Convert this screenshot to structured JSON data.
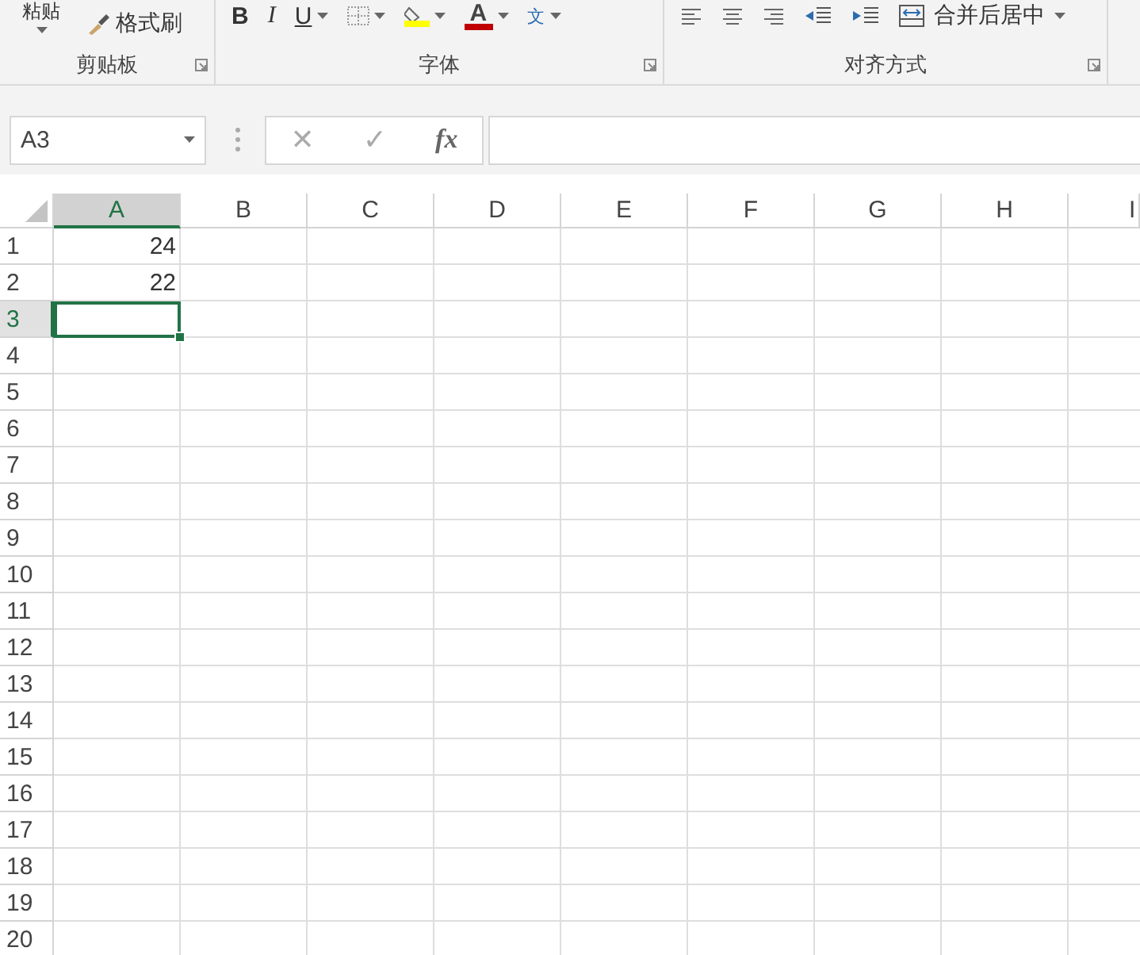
{
  "ribbon": {
    "groups": [
      {
        "label": "剪贴板",
        "items": [
          {
            "kind": "text",
            "label": "粘贴"
          },
          {
            "kind": "brush",
            "label": "格式刷"
          }
        ]
      },
      {
        "label": "字体",
        "items": [
          {
            "kind": "bold",
            "label": "B"
          },
          {
            "kind": "italic",
            "label": "I"
          },
          {
            "kind": "underline",
            "label": "U"
          },
          {
            "kind": "borders"
          },
          {
            "kind": "fill",
            "color": "#ffff00"
          },
          {
            "kind": "fontcolor",
            "label": "A",
            "color": "#c00000"
          },
          {
            "kind": "phonetic",
            "label": "文"
          }
        ]
      },
      {
        "label": "对齐方式",
        "items": [
          {
            "kind": "align-left"
          },
          {
            "kind": "align-center"
          },
          {
            "kind": "align-right"
          },
          {
            "kind": "outdent"
          },
          {
            "kind": "indent"
          },
          {
            "kind": "merge",
            "label": "合并后居中"
          }
        ]
      }
    ]
  },
  "formula_bar": {
    "name_box": "A3",
    "cancel": "✕",
    "enter": "✓",
    "function": "fx"
  },
  "sheet": {
    "columns": [
      {
        "label": "A",
        "selected": true
      },
      {
        "label": "B",
        "selected": false
      },
      {
        "label": "C",
        "selected": false
      },
      {
        "label": "D",
        "selected": false
      },
      {
        "label": "E",
        "selected": false
      },
      {
        "label": "F",
        "selected": false
      },
      {
        "label": "G",
        "selected": false
      },
      {
        "label": "H",
        "selected": false
      },
      {
        "label": "I",
        "selected": false
      }
    ],
    "rows": [
      {
        "label": "1",
        "selected": false,
        "cells": [
          {
            "value": "24",
            "selected": false
          }
        ]
      },
      {
        "label": "2",
        "selected": false,
        "cells": [
          {
            "value": "22",
            "selected": false
          }
        ]
      },
      {
        "label": "3",
        "selected": true,
        "cells": [
          {
            "selected": true
          }
        ]
      },
      {
        "label": "4",
        "selected": false
      },
      {
        "label": "5",
        "selected": false
      },
      {
        "label": "6",
        "selected": false
      },
      {
        "label": "7",
        "selected": false
      },
      {
        "label": "8",
        "selected": false
      },
      {
        "label": "9",
        "selected": false
      },
      {
        "label": "10",
        "selected": false
      },
      {
        "label": "11",
        "selected": false
      },
      {
        "label": "12",
        "selected": false
      },
      {
        "label": "13",
        "selected": false
      },
      {
        "label": "14",
        "selected": false
      },
      {
        "label": "15",
        "selected": false
      },
      {
        "label": "16",
        "selected": false
      },
      {
        "label": "17",
        "selected": false
      },
      {
        "label": "18",
        "selected": false
      },
      {
        "label": "19",
        "selected": false
      },
      {
        "label": "20",
        "selected": false
      }
    ]
  }
}
